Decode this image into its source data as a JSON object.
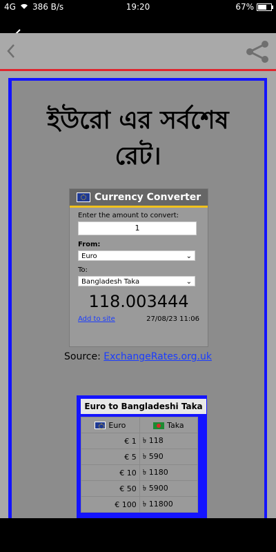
{
  "status_bar": {
    "signal": "4G",
    "data_rate": "386 B/s",
    "time": "19:20",
    "battery_percent": "67%",
    "battery_level": 0.67
  },
  "app_bar": {
    "back_icon": "chevron-left-icon",
    "share_icon": "share-icon"
  },
  "page": {
    "title": "ইউরো এর সর্বশেষ রেট।"
  },
  "converter": {
    "header": "Currency Converter",
    "amount_label": "Enter the amount to convert:",
    "amount_value": "1",
    "from_label": "From:",
    "from_value": "Euro",
    "to_label": "To:",
    "to_value": "Bangladesh Taka",
    "result": "118.003444",
    "add_link": "Add to site",
    "timestamp": "27/08/23 11:06"
  },
  "source": {
    "prefix": "Source: ",
    "link": "ExchangeRates.org.uk"
  },
  "rates_table": {
    "title": "Euro to Bangladeshi Taka",
    "col_euro": "Euro",
    "col_taka": "Taka",
    "rows": [
      {
        "euro": "€ 1",
        "taka": "৳ 118"
      },
      {
        "euro": "€ 5",
        "taka": "৳ 590"
      },
      {
        "euro": "€ 10",
        "taka": "৳ 1180"
      },
      {
        "euro": "€ 50",
        "taka": "৳ 5900"
      },
      {
        "euro": "€ 100",
        "taka": "৳ 11800"
      }
    ]
  }
}
